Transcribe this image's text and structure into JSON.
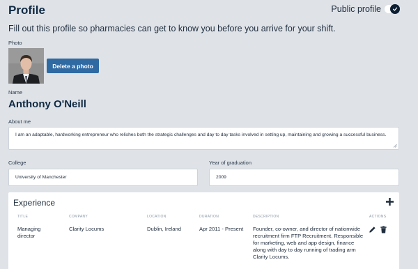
{
  "header": {
    "title": "Profile",
    "public_profile_label": "Public profile",
    "public_profile_on": true
  },
  "intro_text": "Fill out this profile so pharmacies can get to know you before you arrive for your shift.",
  "photo": {
    "label": "Photo",
    "delete_button_label": "Delete a photo"
  },
  "name": {
    "label": "Name",
    "value": "Anthony O'Neill"
  },
  "about": {
    "label": "About me",
    "value": "I am an adaptable, hardworking entrepreneur who relishes both the strategic challenges and day to day tasks involved in setting up, maintaining and growing a successful business."
  },
  "college": {
    "label": "College",
    "value": "University of Manchester"
  },
  "graduation": {
    "label": "Year of graduation",
    "value": "2009"
  },
  "experience": {
    "title": "Experience",
    "columns": {
      "title": "TITLE",
      "company": "COMPANY",
      "location": "LOCATION",
      "duration": "DURATION",
      "description": "DESCRIPTION",
      "actions": "ACTIONS"
    },
    "rows": [
      {
        "title": "Managing director",
        "company": "Clarity Locums",
        "location": "Dublin, Ireland",
        "duration": "Apr 2011 - Present",
        "description": "Founder, co-owner, and director of nationwide recruitment firm FTP Recruitment. Responsible for marketing, web and app design, finance along with day to day running of trading arm Clarity Locums."
      }
    ]
  },
  "colors": {
    "background": "#dfe3e8",
    "primary_button": "#2f6aa3",
    "heading": "#102a43"
  },
  "icons": [
    "check-icon",
    "plus-icon",
    "pencil-icon",
    "trash-icon"
  ]
}
